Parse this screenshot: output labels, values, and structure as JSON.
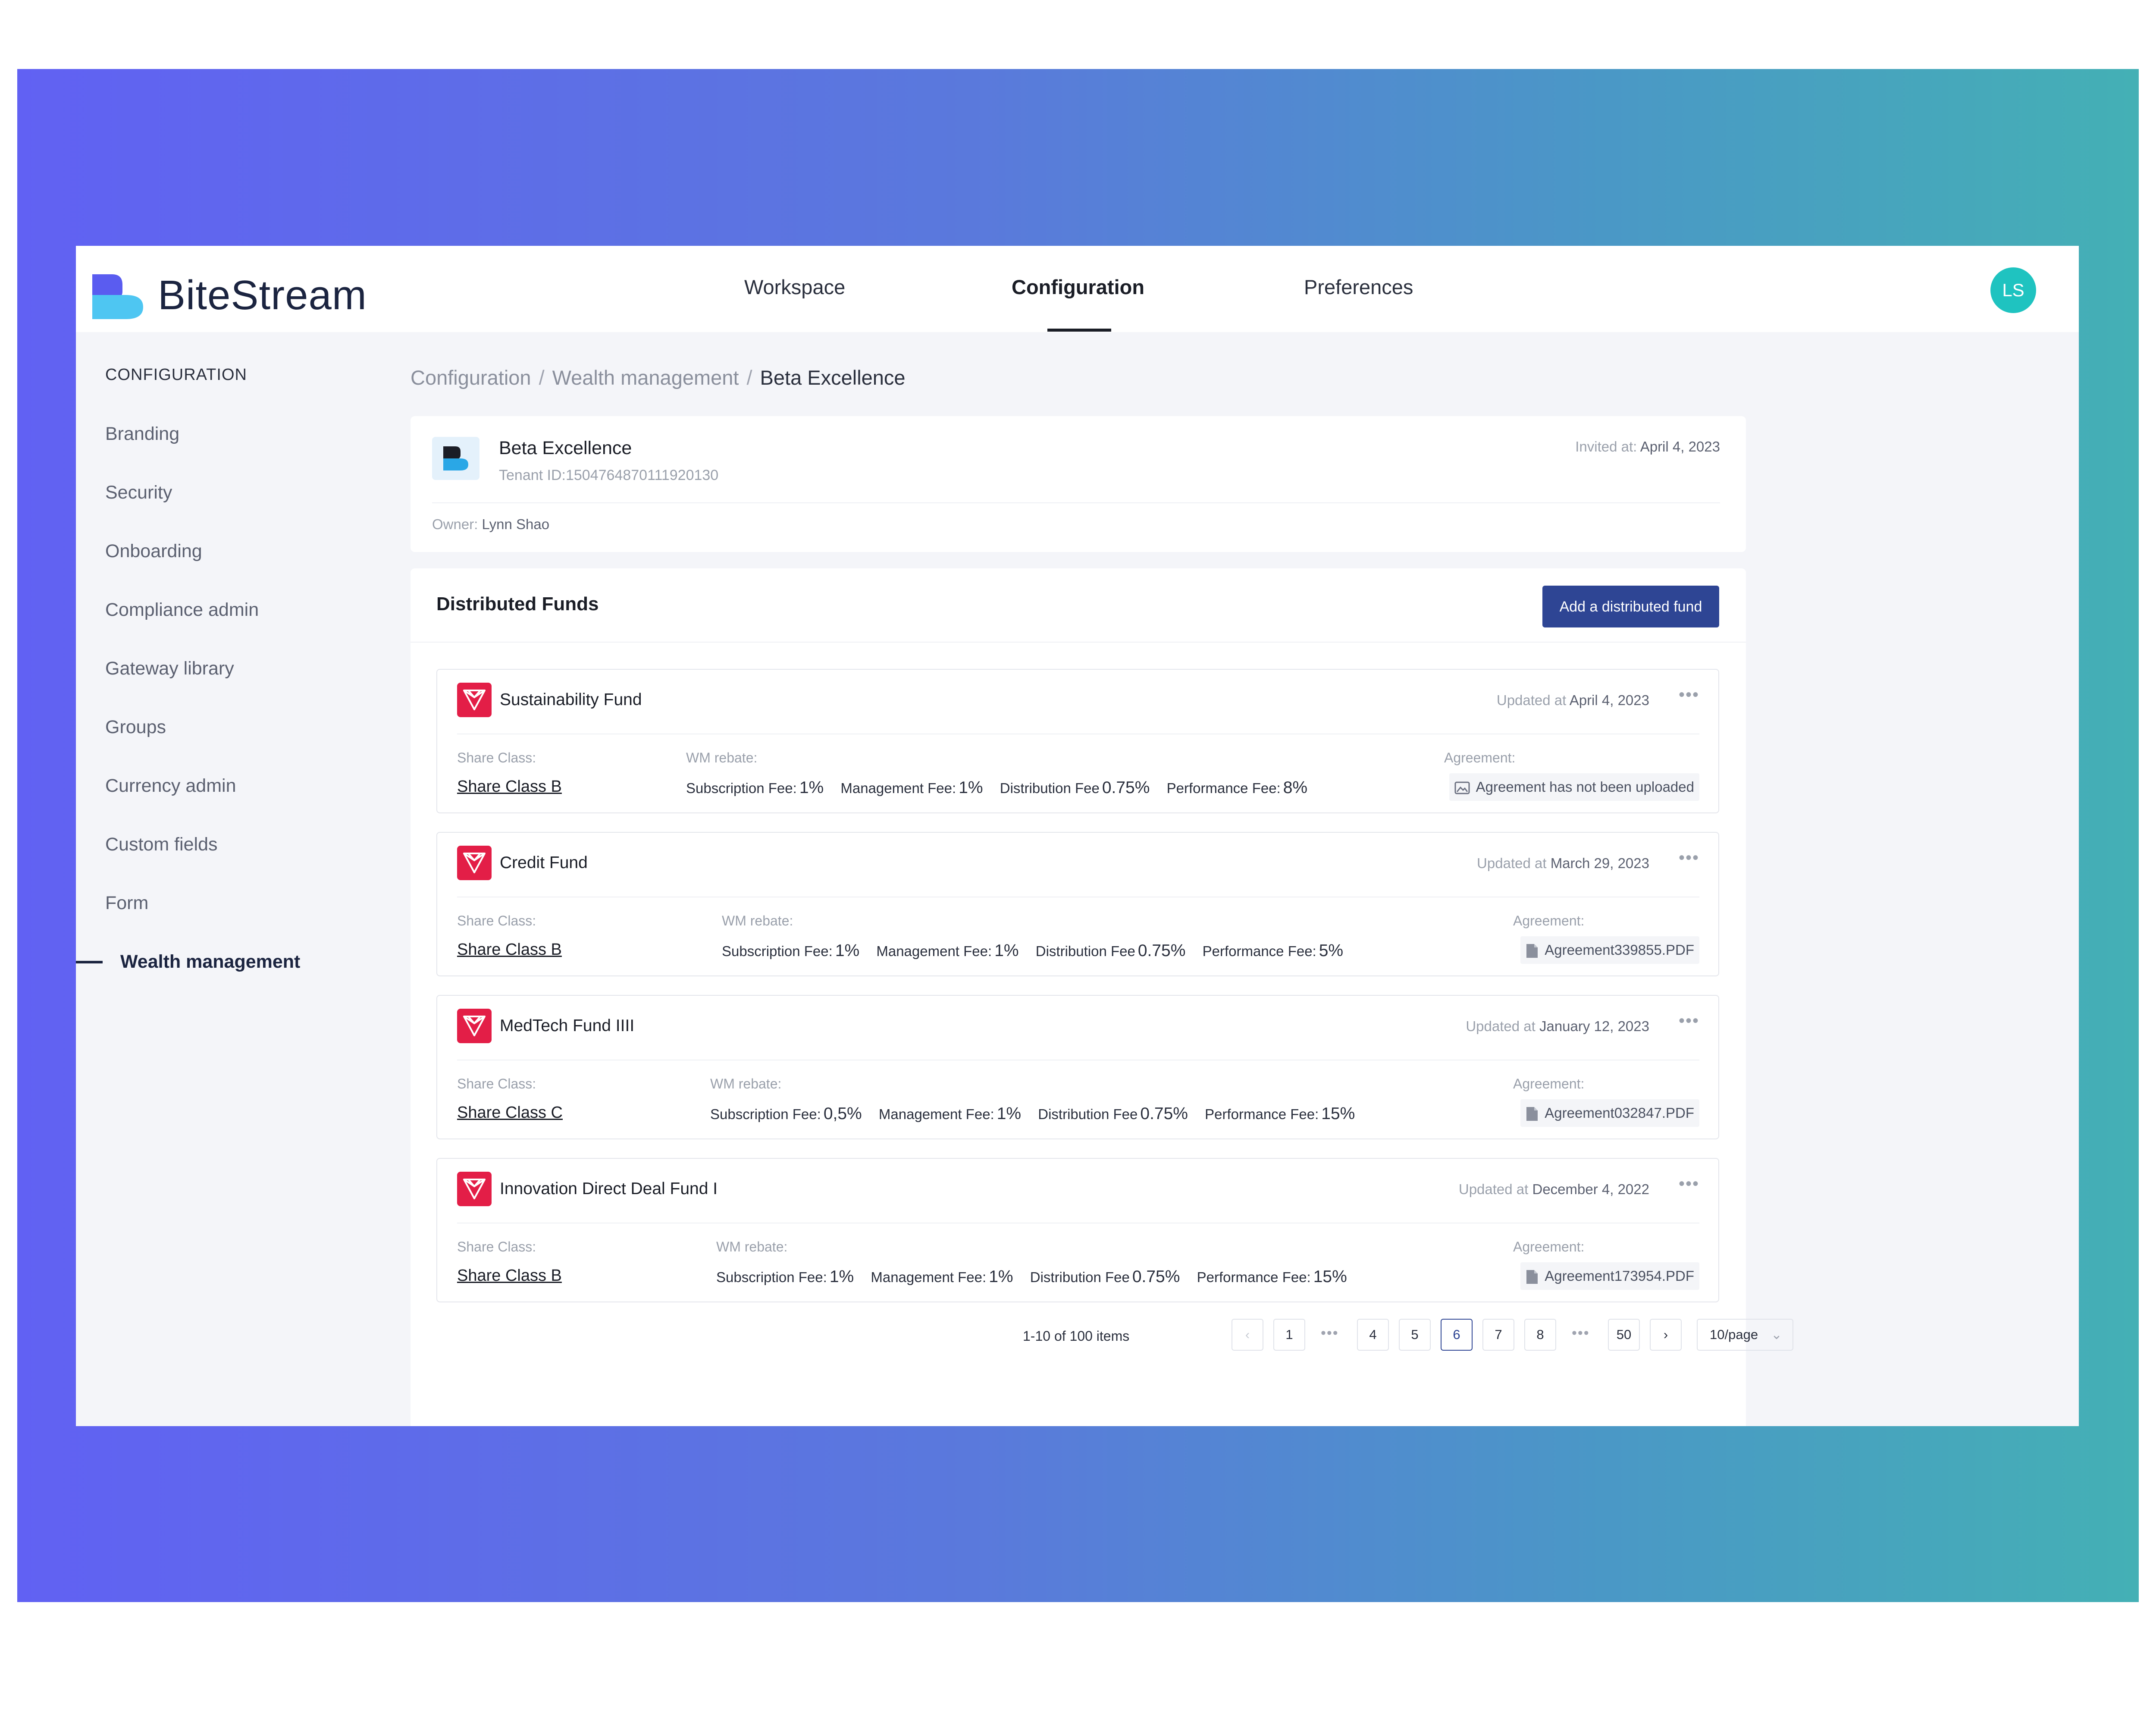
{
  "app": {
    "brand": "BiteStream",
    "user_initials": "LS",
    "colors": {
      "accent": "#2e4594",
      "avatar": "#1fc3c0",
      "fund_icon": "#e31e47",
      "logo_primary": "#5a5cf0",
      "logo_secondary": "#4ec6f2"
    }
  },
  "topnav": {
    "tabs": [
      {
        "label": "Workspace"
      },
      {
        "label": "Configuration"
      },
      {
        "label": "Preferences"
      }
    ],
    "active_tab": "Configuration"
  },
  "sidebar": {
    "title": "CONFIGURATION",
    "items": [
      {
        "label": "Branding"
      },
      {
        "label": "Security"
      },
      {
        "label": "Onboarding"
      },
      {
        "label": "Compliance admin"
      },
      {
        "label": "Gateway library"
      },
      {
        "label": "Groups"
      },
      {
        "label": "Currency admin"
      },
      {
        "label": "Custom fields"
      },
      {
        "label": "Form"
      },
      {
        "label": "Wealth management"
      }
    ],
    "active_item": "Wealth management"
  },
  "breadcrumb": {
    "items": [
      "Configuration",
      "Wealth management",
      "Beta Excellence"
    ],
    "separator": "/"
  },
  "tenant": {
    "name": "Beta Excellence",
    "tenant_id": "Tenant ID:1504764870111920130",
    "invited_label": "Invited at:",
    "invited_value": "April 4, 2023",
    "owner_label": "Owner:",
    "owner_value": "Lynn Shao"
  },
  "funds": {
    "title": "Distributed Funds",
    "add_button": "Add a distributed fund",
    "labels": {
      "share_class": "Share Class:",
      "wm_rebate": "WM rebate:",
      "agreement": "Agreement:",
      "updated_at": "Updated at",
      "subscription_fee": "Subscription Fee:",
      "management_fee": "Management Fee:",
      "distribution_fee": "Distribution Fee",
      "performance_fee": "Performance Fee:"
    },
    "items": [
      {
        "name": "Sustainability Fund",
        "updated": "April 4, 2023",
        "share_class": "Share Class B",
        "subscription_fee": "1%",
        "management_fee": "1%",
        "distribution_fee": "0.75%",
        "performance_fee": "8%",
        "agreement": "Agreement has not been uploaded",
        "agreement_icon": "image-icon"
      },
      {
        "name": "Credit Fund",
        "updated": "March 29, 2023",
        "share_class": "Share Class B",
        "subscription_fee": "1%",
        "management_fee": "1%",
        "distribution_fee": "0.75%",
        "performance_fee": "5%",
        "agreement": "Agreement339855.PDF",
        "agreement_icon": "pdf-file-icon"
      },
      {
        "name": "MedTech Fund IIII",
        "updated": "January 12, 2023",
        "share_class": "Share Class C",
        "subscription_fee": "0,5%",
        "management_fee": "1%",
        "distribution_fee": "0.75%",
        "performance_fee": "15%",
        "agreement": "Agreement032847.PDF",
        "agreement_icon": "pdf-file-icon"
      },
      {
        "name": "Innovation Direct Deal Fund I",
        "updated": "December 4, 2022",
        "share_class": "Share Class B",
        "subscription_fee": "1%",
        "management_fee": "1%",
        "distribution_fee": "0.75%",
        "performance_fee": "15%",
        "agreement": "Agreement173954.PDF",
        "agreement_icon": "pdf-file-icon"
      }
    ]
  },
  "pagination": {
    "total": "1-10 of 100 items",
    "pages": [
      "1",
      "4",
      "5",
      "6",
      "7",
      "8",
      "50"
    ],
    "current": "6",
    "ellipsis": "•••",
    "prev": "‹",
    "next": "›",
    "page_size": "10/page",
    "page_size_chevron": "⌄"
  }
}
